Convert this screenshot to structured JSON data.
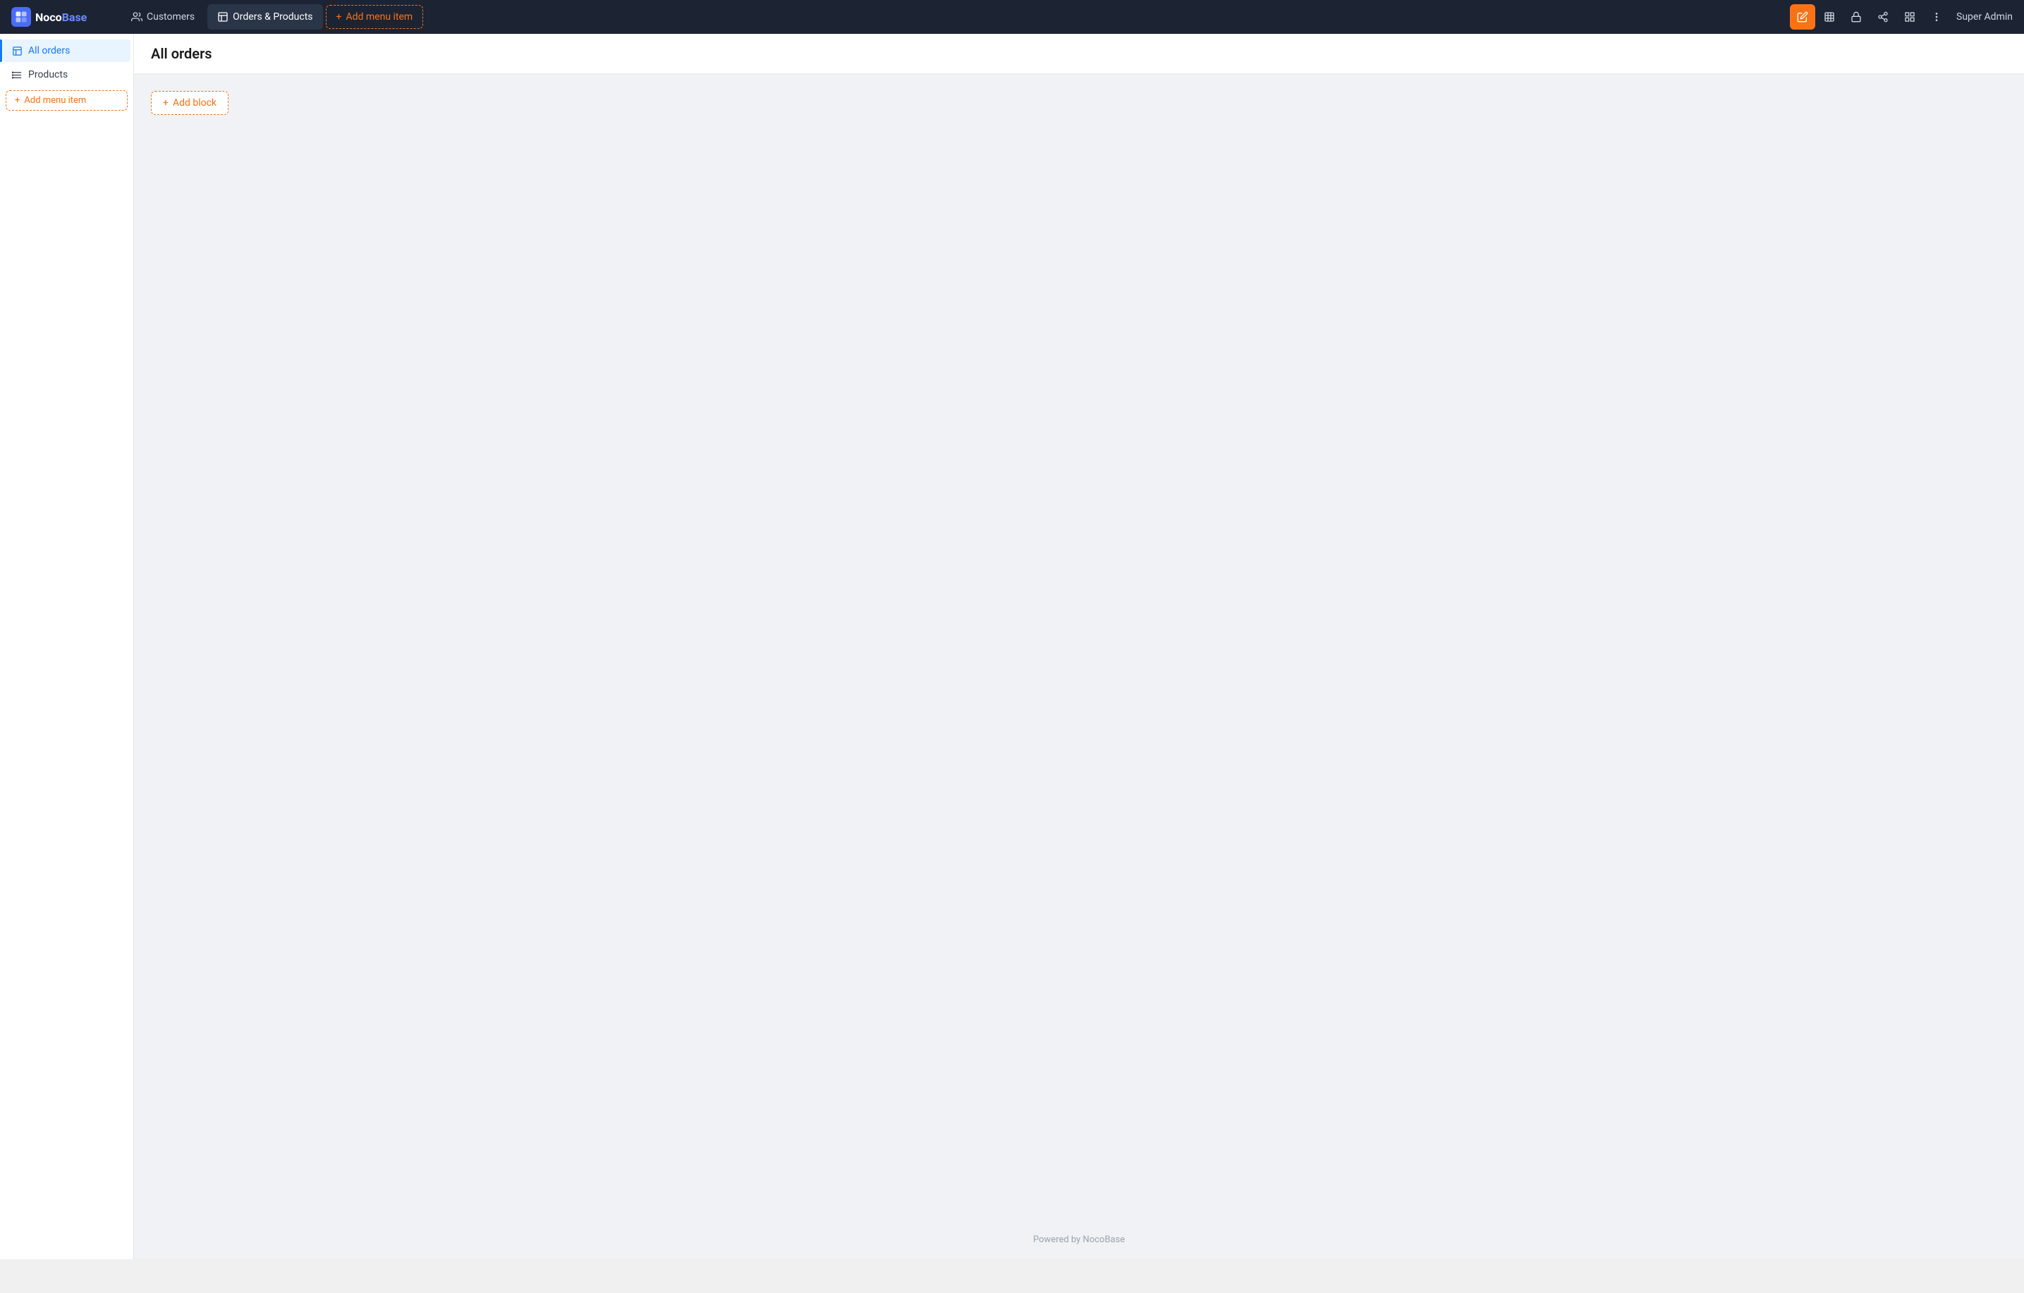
{
  "app": {
    "logo_noco": "Noco",
    "logo_base": "Base"
  },
  "topbar": {
    "customers_label": "Customers",
    "orders_products_label": "Orders & Products",
    "add_menu_item_label": "Add menu item",
    "user_label": "Super Admin"
  },
  "sidebar": {
    "all_orders_label": "All orders",
    "products_label": "Products",
    "add_menu_item_label": "Add menu item"
  },
  "main": {
    "page_title": "All orders",
    "add_block_label": "Add block",
    "powered_by": "Powered by NocoBase"
  },
  "icons": {
    "plus": "+",
    "edit": "✏",
    "grid": "⊞",
    "lock": "🔒",
    "share": "⋈",
    "layout": "▣",
    "more": "⋯"
  }
}
